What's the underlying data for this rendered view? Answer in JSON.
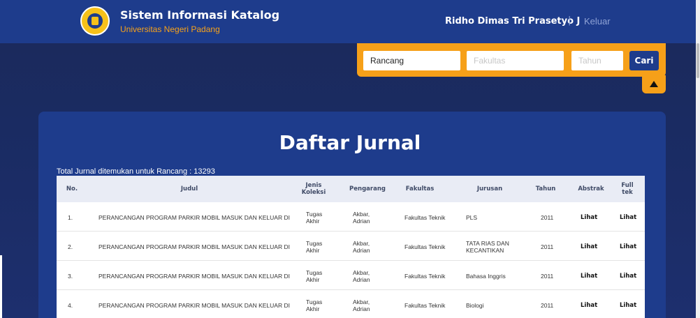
{
  "header": {
    "title": "Sistem Informasi Katalog",
    "subtitle": "Universitas Negeri Padang",
    "user_name": "Ridho Dimas Tri Prasetyo J",
    "separator": "|",
    "logout_label": "Keluar"
  },
  "search": {
    "query_value": "Rancang",
    "faculty_placeholder": "Fakultas",
    "year_placeholder": "Tahun",
    "submit_label": "Cari"
  },
  "main": {
    "heading": "Daftar Jurnal",
    "total_text": "Total Jurnal ditemukan untuk Rancang : 13293"
  },
  "table": {
    "columns": [
      "No.",
      "Judul",
      "Jenis Koleksi",
      "Pengarang",
      "Fakultas",
      "Jurusan",
      "Tahun",
      "Abstrak",
      "Full tek"
    ],
    "rows": [
      {
        "no": "1.",
        "judul": "PERANCANGAN PROGRAM PARKIR MOBIL MASUK DAN KELUAR DI",
        "jenis": "Tugas Akhir",
        "pengarang": "Akbar, Adrian",
        "fakultas": "Fakultas Teknik",
        "jurusan": "PLS",
        "tahun": "2011",
        "abstrak": "Lihat",
        "full": "Lihat"
      },
      {
        "no": "2.",
        "judul": "PERANCANGAN PROGRAM PARKIR MOBIL MASUK DAN KELUAR DI",
        "jenis": "Tugas Akhir",
        "pengarang": "Akbar, Adrian",
        "fakultas": "Fakultas Teknik",
        "jurusan": "TATA RIAS DAN KECANTIKAN",
        "tahun": "2011",
        "abstrak": "Lihat",
        "full": "Lihat"
      },
      {
        "no": "3.",
        "judul": "PERANCANGAN PROGRAM PARKIR MOBIL MASUK DAN KELUAR DI",
        "jenis": "Tugas Akhir",
        "pengarang": "Akbar, Adrian",
        "fakultas": "Fakultas Teknik",
        "jurusan": "Bahasa Inggris",
        "tahun": "2011",
        "abstrak": "Lihat",
        "full": "Lihat"
      },
      {
        "no": "4.",
        "judul": "PERANCANGAN PROGRAM PARKIR MOBIL MASUK DAN KELUAR DI",
        "jenis": "Tugas Akhir",
        "pengarang": "Akbar, Adrian",
        "fakultas": "Fakultas Teknik",
        "jurusan": "Biologi",
        "tahun": "2011",
        "abstrak": "Lihat",
        "full": "Lihat"
      }
    ]
  },
  "colors": {
    "primary": "#1e3c8c",
    "accent": "#f6a019"
  }
}
